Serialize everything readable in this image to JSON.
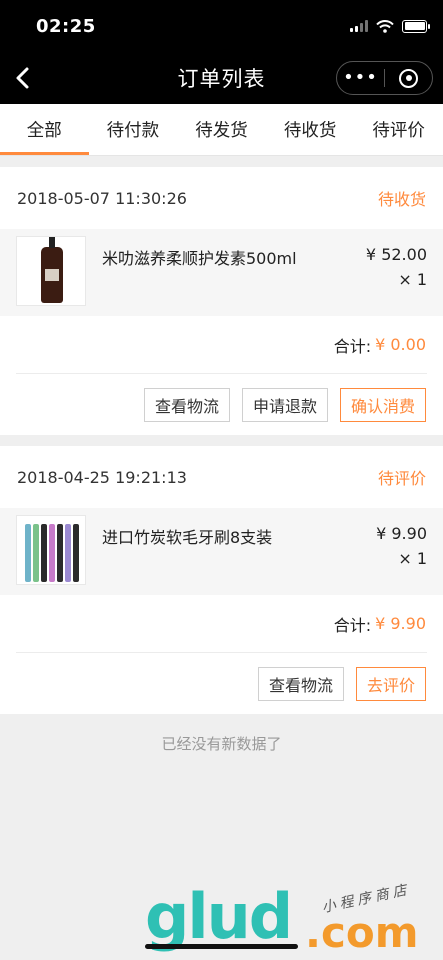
{
  "status_bar": {
    "time": "02:25"
  },
  "nav": {
    "title": "订单列表"
  },
  "tabs": [
    {
      "label": "全部",
      "active": true
    },
    {
      "label": "待付款",
      "active": false
    },
    {
      "label": "待发货",
      "active": false
    },
    {
      "label": "待收货",
      "active": false
    },
    {
      "label": "待评价",
      "active": false
    }
  ],
  "orders": [
    {
      "date": "2018-05-07 11:30:26",
      "status": "待收货",
      "item": {
        "name": "米叻滋养柔顺护发素500ml",
        "price": "¥ 52.00",
        "qty": "× 1"
      },
      "total_label": "合计:",
      "total": "¥ 0.00",
      "buttons": [
        "查看物流",
        "申请退款",
        "确认消费"
      ]
    },
    {
      "date": "2018-04-25 19:21:13",
      "status": "待评价",
      "item": {
        "name": "进口竹炭软毛牙刷8支装",
        "price": "¥ 9.90",
        "qty": "× 1"
      },
      "total_label": "合计:",
      "total": "¥ 9.90",
      "buttons": [
        "查看物流",
        "去评价"
      ]
    }
  ],
  "empty_tip": "已经没有新数据了",
  "watermark": {
    "big": "glud",
    "com": ".com",
    "small": "小程序商店"
  },
  "colors": {
    "accent": "#ff8a3d",
    "bar": "#000000",
    "bg": "#efefef"
  }
}
